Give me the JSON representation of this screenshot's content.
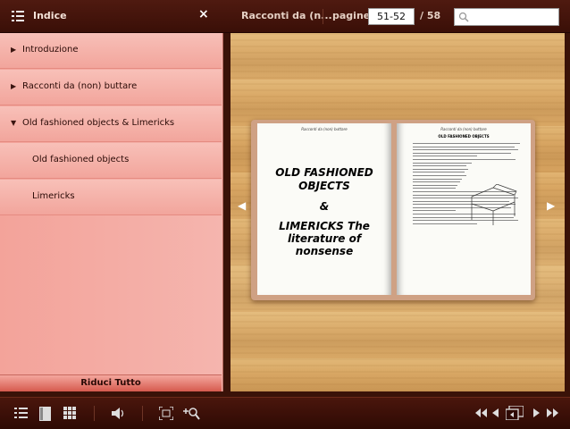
{
  "header": {
    "index_title": "Indice",
    "close_label": "×",
    "document_title": "Racconti da (n...",
    "pages_label": "pagine:",
    "current_pages": "51-52",
    "total_pages": "/ 58",
    "search_placeholder": ""
  },
  "sidebar": {
    "items": [
      {
        "label": "Introduzione",
        "arrow": "▶",
        "level": 0
      },
      {
        "label": "Racconti da (non) buttare",
        "arrow": "▶",
        "level": 0
      },
      {
        "label": "Old fashioned objects & Limericks",
        "arrow": "▼",
        "level": 0
      },
      {
        "label": "Old fashioned objects",
        "arrow": "",
        "level": 1
      },
      {
        "label": "Limericks",
        "arrow": "",
        "level": 1
      }
    ],
    "footer_label": "Riduci Tutto"
  },
  "book": {
    "left_running_head": "Racconti da (non) buttare",
    "right_running_head": "Racconti da (non) buttare",
    "cover_title": "OLD FASHIONED OBJECTS",
    "cover_amp": "&",
    "cover_subtitle": "LIMERICKS The literature of nonsense",
    "right_heading": "OLD FASHIONED OBJECTS"
  },
  "toolbar": {
    "icons": [
      "index-icon",
      "single-page-icon",
      "thumbnails-icon",
      "sound-icon",
      "fullscreen-icon",
      "zoom-icon",
      "first-page-icon",
      "prev-page-icon",
      "spread-view-icon",
      "next-page-icon",
      "last-page-icon"
    ]
  },
  "colors": {
    "chrome": "#3a0f07",
    "sidebar": "#f4a79e",
    "wood": "#d9a864"
  }
}
